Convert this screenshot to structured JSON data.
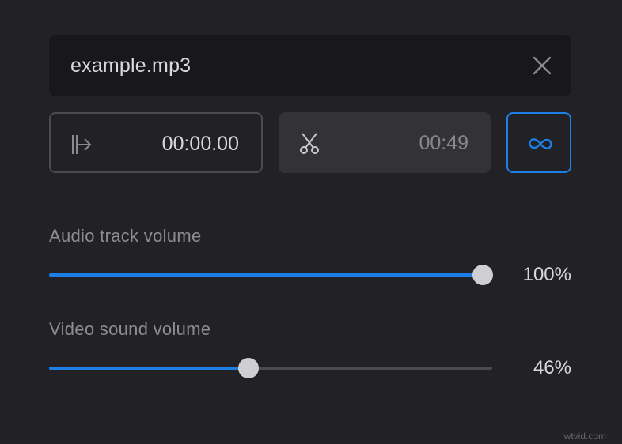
{
  "audio_file": {
    "name": "example.mp3",
    "close_icon": "close-icon"
  },
  "trim": {
    "start_time": "00:00.00",
    "start_icon": "trim-start-icon",
    "end_time": "00:49",
    "end_icon": "scissors-icon"
  },
  "loop": {
    "icon": "infinity-icon",
    "active": true
  },
  "audio_track_volume": {
    "label": "Audio track volume",
    "value_text": "100%",
    "value": 1.0
  },
  "video_sound_volume": {
    "label": "Video sound volume",
    "value_text": "46%",
    "value": 0.46
  },
  "colors": {
    "accent": "#1b7fe6",
    "background": "#222226"
  },
  "watermark": "wtvid.com"
}
